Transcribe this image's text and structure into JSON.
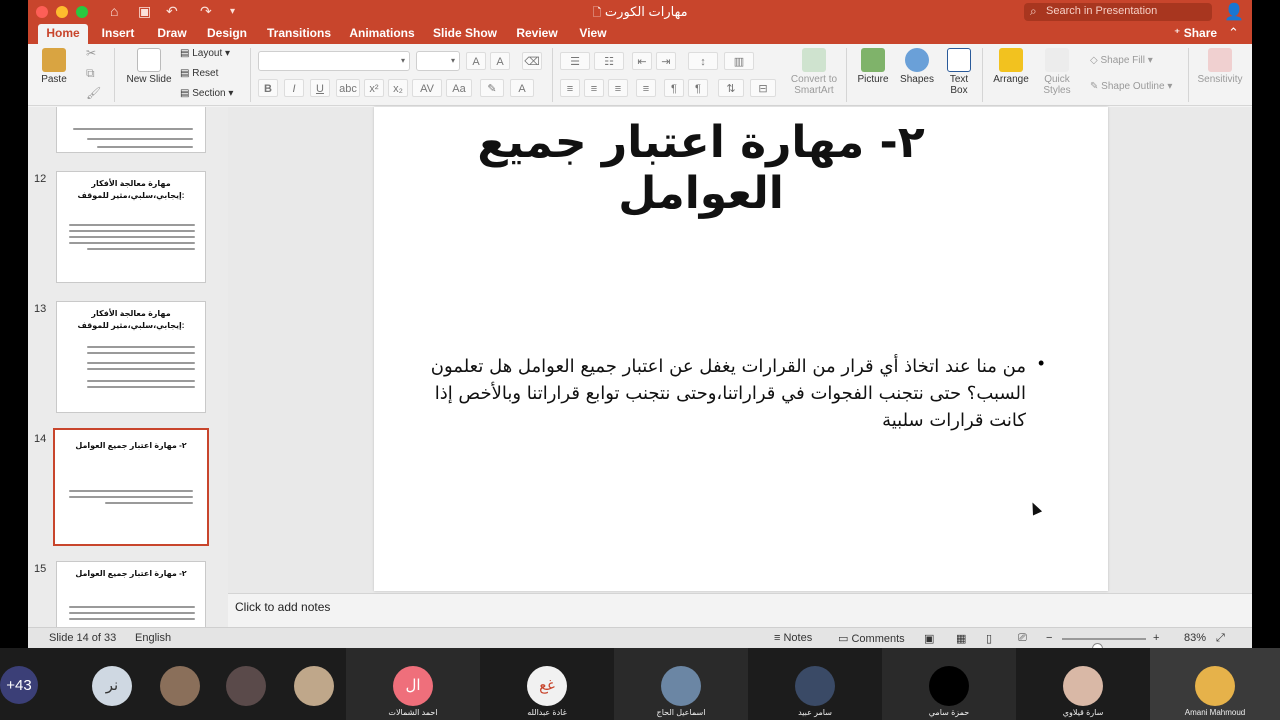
{
  "window": {
    "title": "مهارات الكورت",
    "search_placeholder": "Search in Presentation",
    "share_label": "Share"
  },
  "tabs": [
    {
      "label": "Home",
      "active": true
    },
    {
      "label": "Insert"
    },
    {
      "label": "Draw"
    },
    {
      "label": "Design"
    },
    {
      "label": "Transitions"
    },
    {
      "label": "Animations"
    },
    {
      "label": "Slide Show"
    },
    {
      "label": "Review"
    },
    {
      "label": "View"
    }
  ],
  "ribbon": {
    "paste": "Paste",
    "new_slide": "New Slide",
    "layout": "Layout",
    "reset": "Reset",
    "section": "Section",
    "convert_smartart": "Convert to SmartArt",
    "picture": "Picture",
    "shapes": "Shapes",
    "text_box": "Text Box",
    "arrange": "Arrange",
    "quick_styles": "Quick Styles",
    "shape_fill": "Shape Fill",
    "shape_outline": "Shape Outline",
    "sensitivity": "Sensitivity"
  },
  "thumbnails": [
    {
      "num": "",
      "title": ""
    },
    {
      "num": "12",
      "title": "مهارة معالجة الأفكار :إيجابي،سلبي،مثير للموقف"
    },
    {
      "num": "13",
      "title": "مهارة معالجة الأفكار :إيجابي،سلبي،مثير للموقف"
    },
    {
      "num": "14",
      "title": "٢- مهارة اعتبار جميع العوامل",
      "selected": true
    },
    {
      "num": "15",
      "title": "٢- مهارة اعتبار جميع العوامل"
    }
  ],
  "slide": {
    "title": "٢- مهارة اعتبار جميع العوامل",
    "body": "من منا عند اتخاذ أي قرار من القرارات يغفل عن اعتبار جميع العوامل هل تعلمون السبب؟ حتى نتجنب الفجوات في قراراتنا،وحتى نتجنب توابع قراراتنا وبالأخص إذا كانت قرارات سلبية"
  },
  "notes_placeholder": "Click to add notes",
  "status": {
    "slide_info": "Slide 14 of 33",
    "language": "English",
    "notes": "Notes",
    "comments": "Comments",
    "zoom": "83%",
    "zoom_level": 0.42
  },
  "participants": [
    {
      "name": "",
      "initials": "+43",
      "color": "#3b3f77"
    },
    {
      "name": "",
      "initials": "نر",
      "color": "#cfd8e2"
    },
    {
      "name": "",
      "initials": "",
      "color": "#8a6f5a"
    },
    {
      "name": "",
      "initials": "",
      "color": "#5a4a4a"
    },
    {
      "name": "",
      "initials": "",
      "color": "#bfa78a"
    },
    {
      "name": "احمد الشمالات",
      "initials": "ال",
      "color": "#ef6f7b"
    },
    {
      "name": "غادة عبدالله",
      "initials": "غع",
      "color": "#f1f1f1"
    },
    {
      "name": "اسماعيل الحاج",
      "initials": "",
      "color": "#6b86a4"
    },
    {
      "name": "سامر عبيد",
      "initials": "",
      "color": "#3a4a66"
    },
    {
      "name": "حمزة سامي",
      "initials": "",
      "color": "#000000"
    },
    {
      "name": "سارة قيلاوي",
      "initials": "",
      "color": "#d9b8a6"
    },
    {
      "name": "Amani Mahmoud",
      "initials": "",
      "color": "#e6b24a"
    }
  ]
}
